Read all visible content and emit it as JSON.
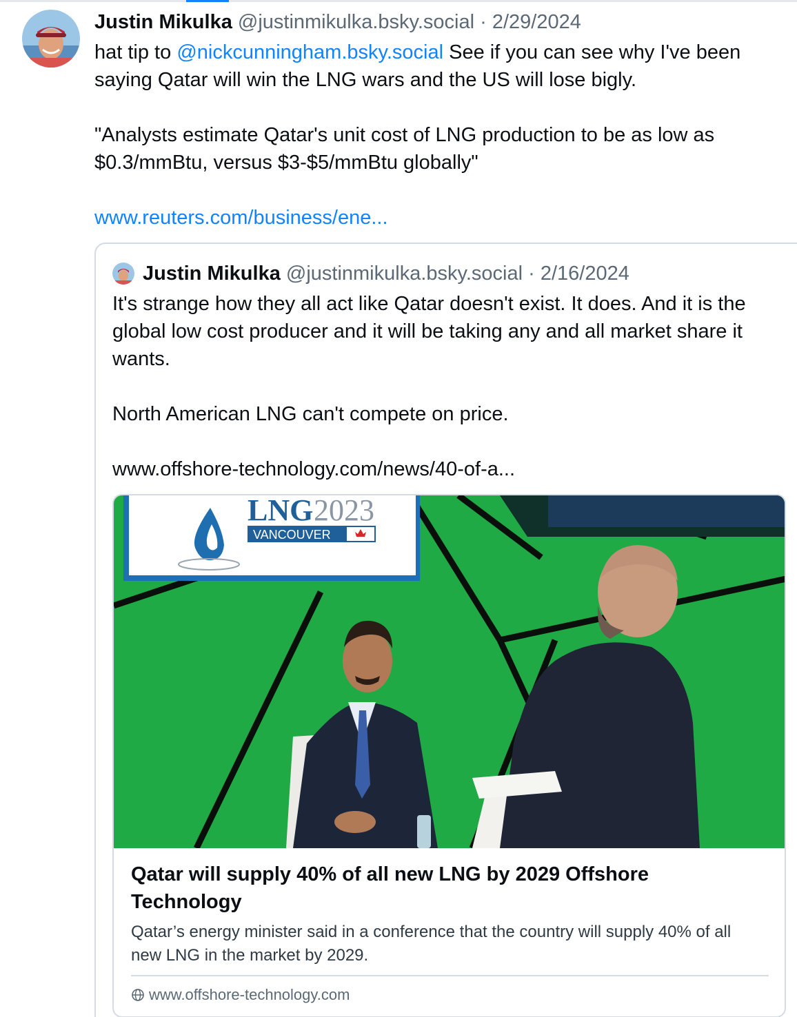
{
  "post": {
    "author": {
      "name": "Justin Mikulka",
      "handle": "@justinmikulka.bsky.social"
    },
    "separator": "·",
    "date": "2/29/2024",
    "text": {
      "intro": "hat tip to",
      "mention": "@nickcunningham.bsky.social",
      "line1_rest": "See if you can see why I've been saying Qatar will win the LNG wars and the US will lose bigly.",
      "quote": "\"Analysts estimate Qatar's unit cost of LNG production to be as low as $0.3/mmBtu, versus $3-$5/mmBtu globally\"",
      "link": "www.reuters.com/business/ene..."
    }
  },
  "quoted_post": {
    "author": {
      "name": "Justin Mikulka",
      "handle": "@justinmikulka.bsky.social"
    },
    "separator": "·",
    "date": "2/16/2024",
    "paragraph1": "It's strange how they all act like Qatar doesn't exist. It does. And it is the global low cost producer and it will be taking any and all market share it wants.",
    "paragraph2": "North American LNG can't compete on price.",
    "link": "www.offshore-technology.com/news/40-of-a..."
  },
  "link_card": {
    "image": {
      "logo_lng": "LNG",
      "logo_year": "2023",
      "logo_city": "VANCOUVER"
    },
    "title": "Qatar will supply 40% of all new LNG by 2029 Offshore Technology",
    "description": "Qatar’s energy minister said in a conference that the country will supply 40% of all new LNG in the market by 2029.",
    "domain": "www.offshore-technology.com",
    "domain_icon": "globe-icon"
  },
  "colors": {
    "link": "#1083fe",
    "text": "#0b0f14",
    "muted": "#5b6875",
    "border": "#d4dbe2",
    "stage_green": "#24b34b"
  }
}
